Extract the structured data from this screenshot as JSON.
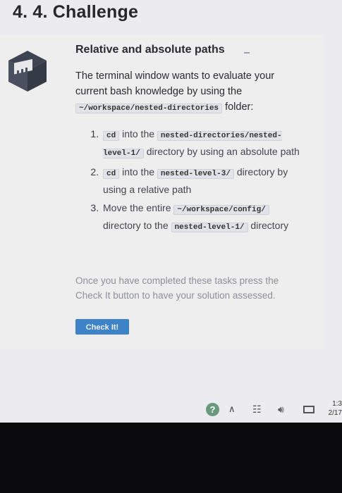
{
  "page": {
    "heading": "4. 4. Challenge"
  },
  "challenge": {
    "title": "Relative and absolute paths",
    "intro_text": "The terminal window wants to evaluate your current bash knowledge by using the",
    "intro_code": "~/workspace/nested-directories",
    "intro_suffix": "folder:",
    "tasks": [
      {
        "code1": "cd",
        "text1": "into the",
        "code2": "nested-directories/nested-level-1/",
        "text2": "directory by using an absolute path"
      },
      {
        "code1": "cd",
        "text1": "into the",
        "code2": "nested-level-3/",
        "text2": "directory by using a relative path"
      },
      {
        "text0": "Move the entire",
        "code1": "~/workspace/config/",
        "text1": "directory to the",
        "code2": "nested-level-1/",
        "text2": "directory"
      }
    ],
    "outro": "Once you have completed these tasks press the Check It button to have your solution assessed.",
    "check_button": "Check It!"
  },
  "taskbar": {
    "help_glyph": "?",
    "clock_time": "1:3",
    "clock_date": "2/17"
  },
  "colors": {
    "accent": "#3e82c8",
    "background": "#ecebef"
  }
}
